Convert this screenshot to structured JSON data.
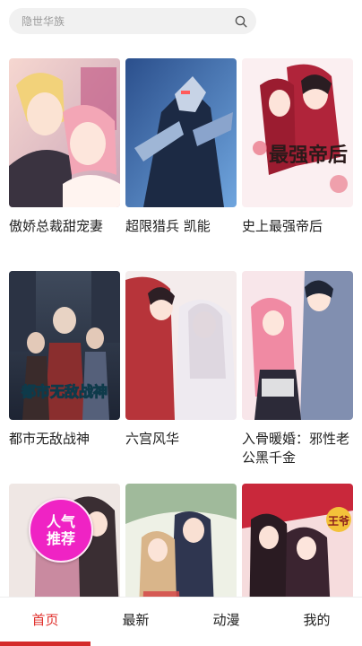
{
  "search": {
    "placeholder": "隐世华族"
  },
  "comics": [
    {
      "title": "傲娇总裁甜宠妻",
      "cover": "romance-ceo"
    },
    {
      "title": "超限猎兵 凯能",
      "cover": "mecha"
    },
    {
      "title": "史上最强帝后",
      "cover": "empress",
      "cover_text": "最强帝后"
    },
    {
      "title": "都市无敌战神",
      "cover": "urban-war-god",
      "cover_text": "都市无敌战神"
    },
    {
      "title": "六宫风华",
      "cover": "palace"
    },
    {
      "title": "入骨暖婚：邪性老公黑千金",
      "cover": "warm-marriage"
    },
    {
      "title": "",
      "cover": "popular",
      "badge": [
        "人气",
        "推荐"
      ]
    },
    {
      "title": "",
      "cover": "ancient-couple"
    },
    {
      "title": "",
      "cover": "red-hanfu",
      "cover_text": "王爷"
    }
  ],
  "tabs": [
    {
      "label": "首页",
      "active": true
    },
    {
      "label": "最新",
      "active": false
    },
    {
      "label": "动漫",
      "active": false
    },
    {
      "label": "我的",
      "active": false
    }
  ],
  "colors": {
    "accent": "#e0312d",
    "badge": "#ef23c4",
    "search_bg": "#f1f1f1"
  }
}
